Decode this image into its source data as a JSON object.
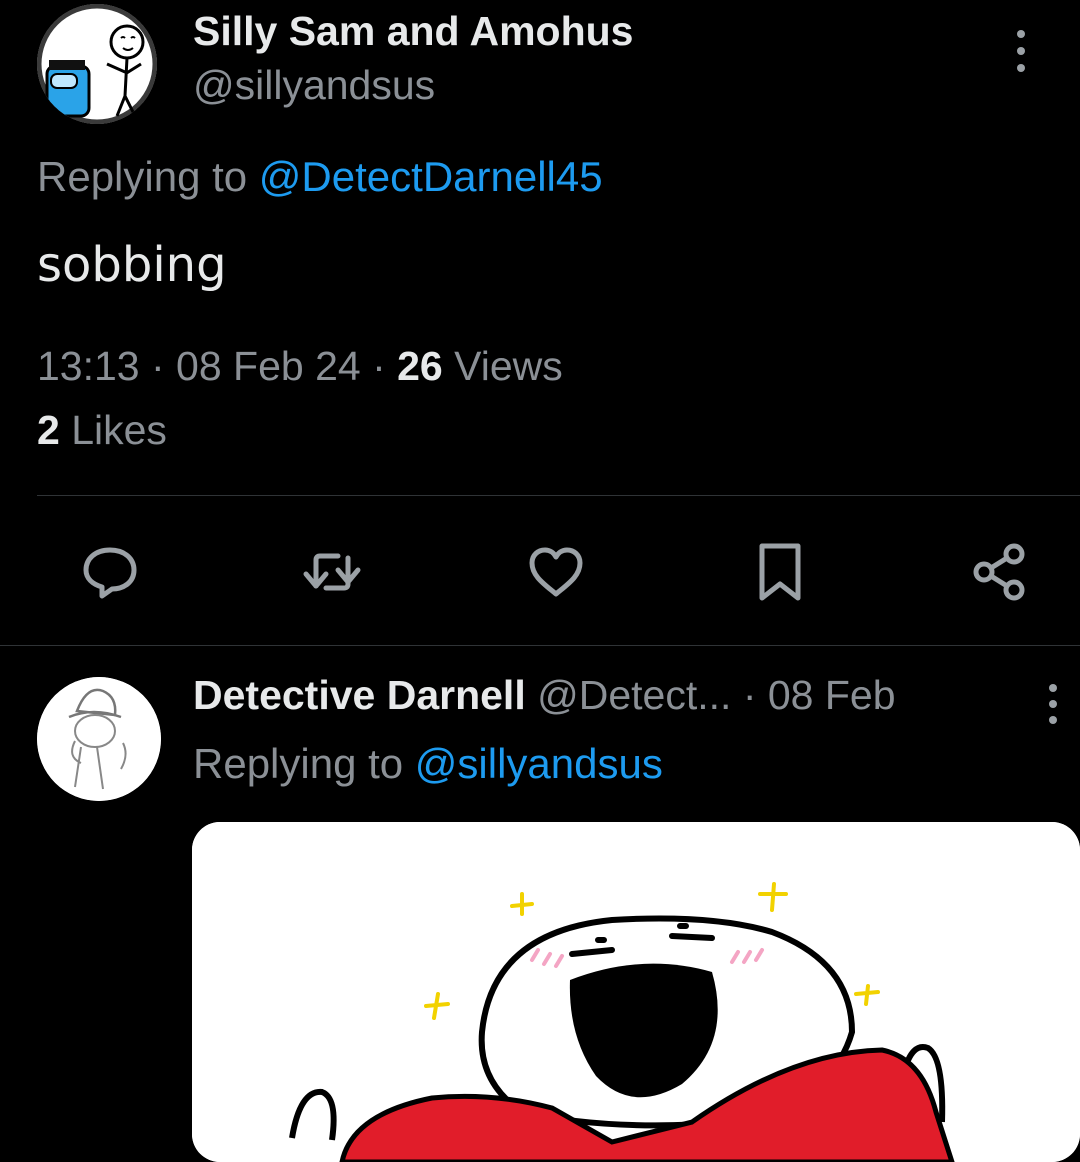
{
  "main_tweet": {
    "display_name": "Silly Sam and Amohus",
    "handle": "@sillyandsus",
    "replying_prefix": "Replying to ",
    "replying_handle": "@DetectDarnell45",
    "text": "sobbing",
    "time": "13:13",
    "separator": " · ",
    "date": "08 Feb 24",
    "views_count": "26",
    "views_label": " Views",
    "likes_count": "2",
    "likes_label": " Likes",
    "avatar_icon": "cartoon-avatar-icon"
  },
  "actions": [
    {
      "name": "reply",
      "icon": "comment-icon"
    },
    {
      "name": "repost",
      "icon": "retweet-icon"
    },
    {
      "name": "like",
      "icon": "heart-icon"
    },
    {
      "name": "bookmark",
      "icon": "bookmark-icon"
    },
    {
      "name": "share",
      "icon": "share-icon"
    }
  ],
  "reply_tweet": {
    "display_name": "Detective Darnell",
    "handle": "@Detect...",
    "separator": " · ",
    "date": "08 Feb",
    "replying_prefix": "Replying to ",
    "replying_handle": "@sillyandsus",
    "avatar_icon": "detective-avatar-icon",
    "media": "laughing-cartoon-image"
  },
  "colors": {
    "background": "#000000",
    "text_primary": "#e7e9ea",
    "text_secondary": "#8b9096",
    "link": "#1d9bf0",
    "divider": "#2f3336",
    "icon": "#9ba1a6"
  }
}
